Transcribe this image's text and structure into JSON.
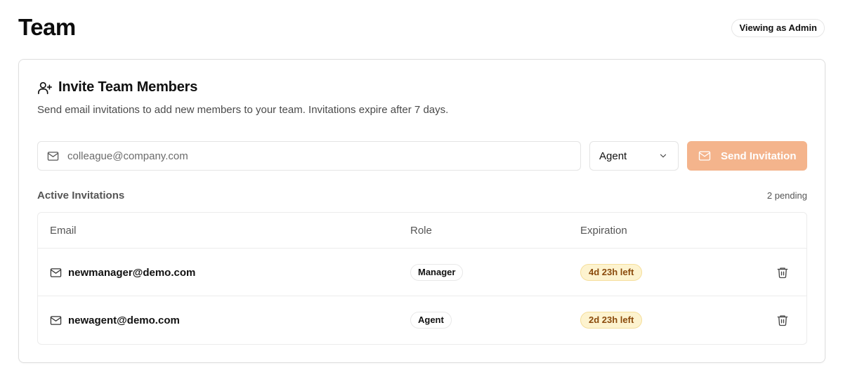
{
  "page": {
    "title": "Team",
    "viewing_badge": "Viewing as Admin"
  },
  "invite": {
    "title": "Invite Team Members",
    "description": "Send email invitations to add new members to your team. Invitations expire after 7 days.",
    "email_placeholder": "colleague@company.com",
    "role_selected": "Agent",
    "send_label": "Send Invitation",
    "send_button_color": "#f4b48c",
    "icons": {
      "header": "user-plus-icon",
      "input": "mail-icon",
      "select": "chevron-down-icon",
      "send": "mail-icon"
    }
  },
  "invitations": {
    "label": "Active Invitations",
    "pending": "2 pending",
    "columns": {
      "email": "Email",
      "role": "Role",
      "expiration": "Expiration"
    },
    "rows": [
      {
        "email": "newmanager@demo.com",
        "role": "Manager",
        "expiration": "4d 23h left"
      },
      {
        "email": "newagent@demo.com",
        "role": "Agent",
        "expiration": "2d 23h left"
      }
    ],
    "expiration_badge_color": "#fdf3cf"
  }
}
